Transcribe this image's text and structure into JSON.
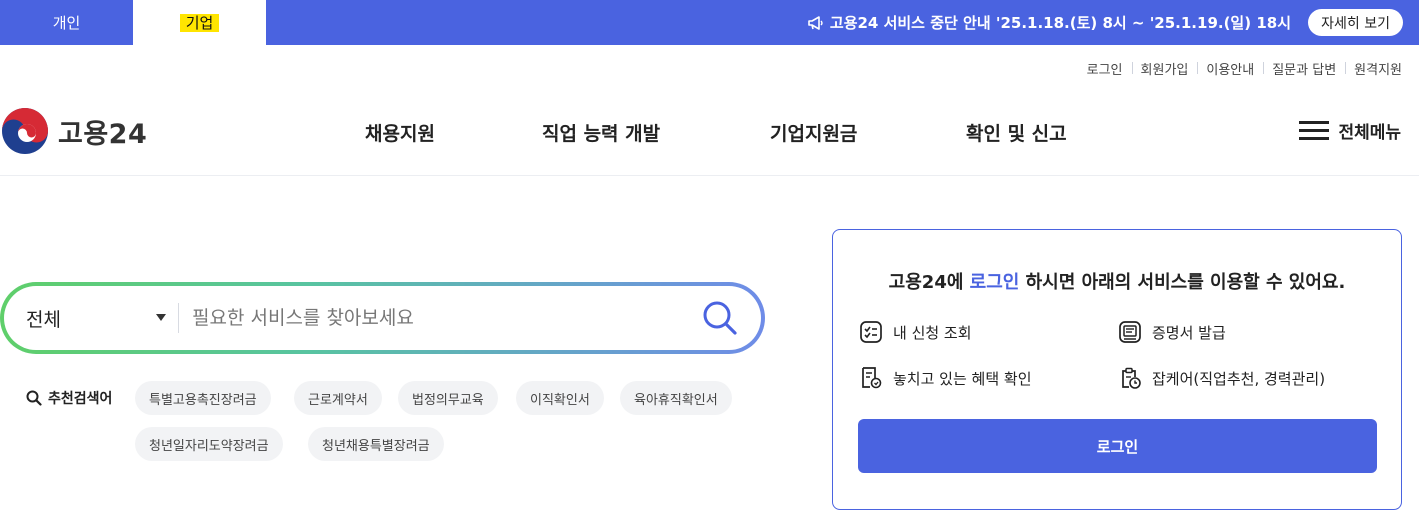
{
  "top_tabs": {
    "personal": "개인",
    "business": "기업"
  },
  "notice": {
    "text": "고용24 서비스 중단 안내 '25.1.18.(토) 8시 ~ '25.1.19.(일) 18시",
    "button": "자세히 보기"
  },
  "util_links": [
    "로그인",
    "회원가입",
    "이용안내",
    "질문과 답변",
    "원격지원"
  ],
  "logo": {
    "text": "고용24"
  },
  "gnb": [
    "채용지원",
    "직업 능력 개발",
    "기업지원금",
    "확인 및 신고"
  ],
  "all_menu": "전체메뉴",
  "search": {
    "category": "전체",
    "placeholder": "필요한 서비스를 찾아보세요"
  },
  "keywords": {
    "label": "추천검색어",
    "items": [
      "특별고용촉진장려금",
      "근로계약서",
      "법정의무교육",
      "이직확인서",
      "육아휴직확인서",
      "청년일자리도약장려금",
      "청년채용특별장려금"
    ]
  },
  "login_card": {
    "title_pre": "고용24에 ",
    "title_hl": "로그인",
    "title_post": " 하시면 아래의 서비스를 이용할 수 있어요.",
    "services": [
      "내 신청 조회",
      "증명서 발급",
      "놓치고 있는 혜택 확인",
      "잡케어(직업추천, 경력관리)"
    ],
    "button": "로그인"
  },
  "colors": {
    "primary": "#4a63e0",
    "highlight": "#ffe500",
    "gradient_start": "#5fcf6a",
    "gradient_end": "#6f8ce8"
  }
}
